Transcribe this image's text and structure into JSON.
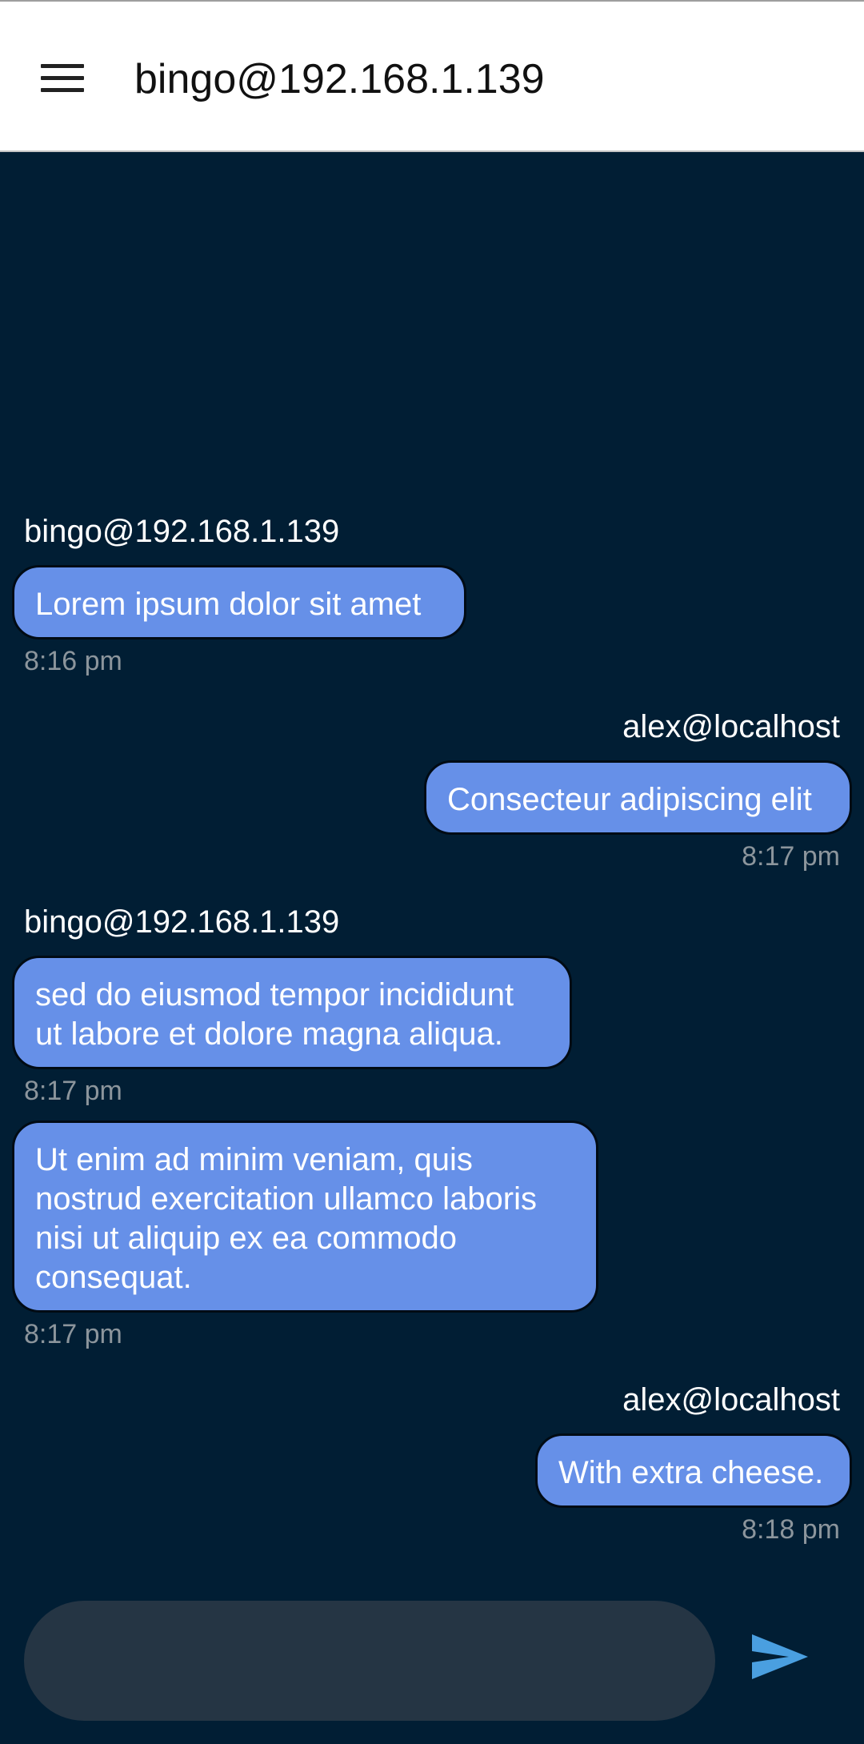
{
  "app_bar": {
    "title": "bingo@192.168.1.139",
    "menu_icon": "hamburger-menu-icon"
  },
  "messages": [
    {
      "sender": "bingo@192.168.1.139",
      "side": "left",
      "text": "Lorem ipsum dolor sit amet",
      "time": "8:16 pm"
    },
    {
      "sender": "alex@localhost",
      "side": "right",
      "text": "Consecteur adipiscing elit",
      "time": "8:17 pm"
    },
    {
      "sender": "bingo@192.168.1.139",
      "side": "left",
      "text": "sed do eiusmod tempor incididunt ut labore et dolore magna aliqua.",
      "time": "8:17 pm"
    },
    {
      "sender": "",
      "side": "left",
      "text": "Ut enim ad minim veniam, quis nostrud exercitation ullamco laboris nisi ut aliquip ex ea commodo consequat.",
      "time": "8:17 pm"
    },
    {
      "sender": "alex@localhost",
      "side": "right",
      "text": "With extra cheese.",
      "time": "8:18 pm"
    }
  ],
  "composer": {
    "value": "",
    "placeholder": "",
    "send_icon": "send-icon"
  },
  "colors": {
    "background": "#011e34",
    "bubble": "#6690e8",
    "input": "#253544",
    "send_accent": "#4a9fe0"
  }
}
